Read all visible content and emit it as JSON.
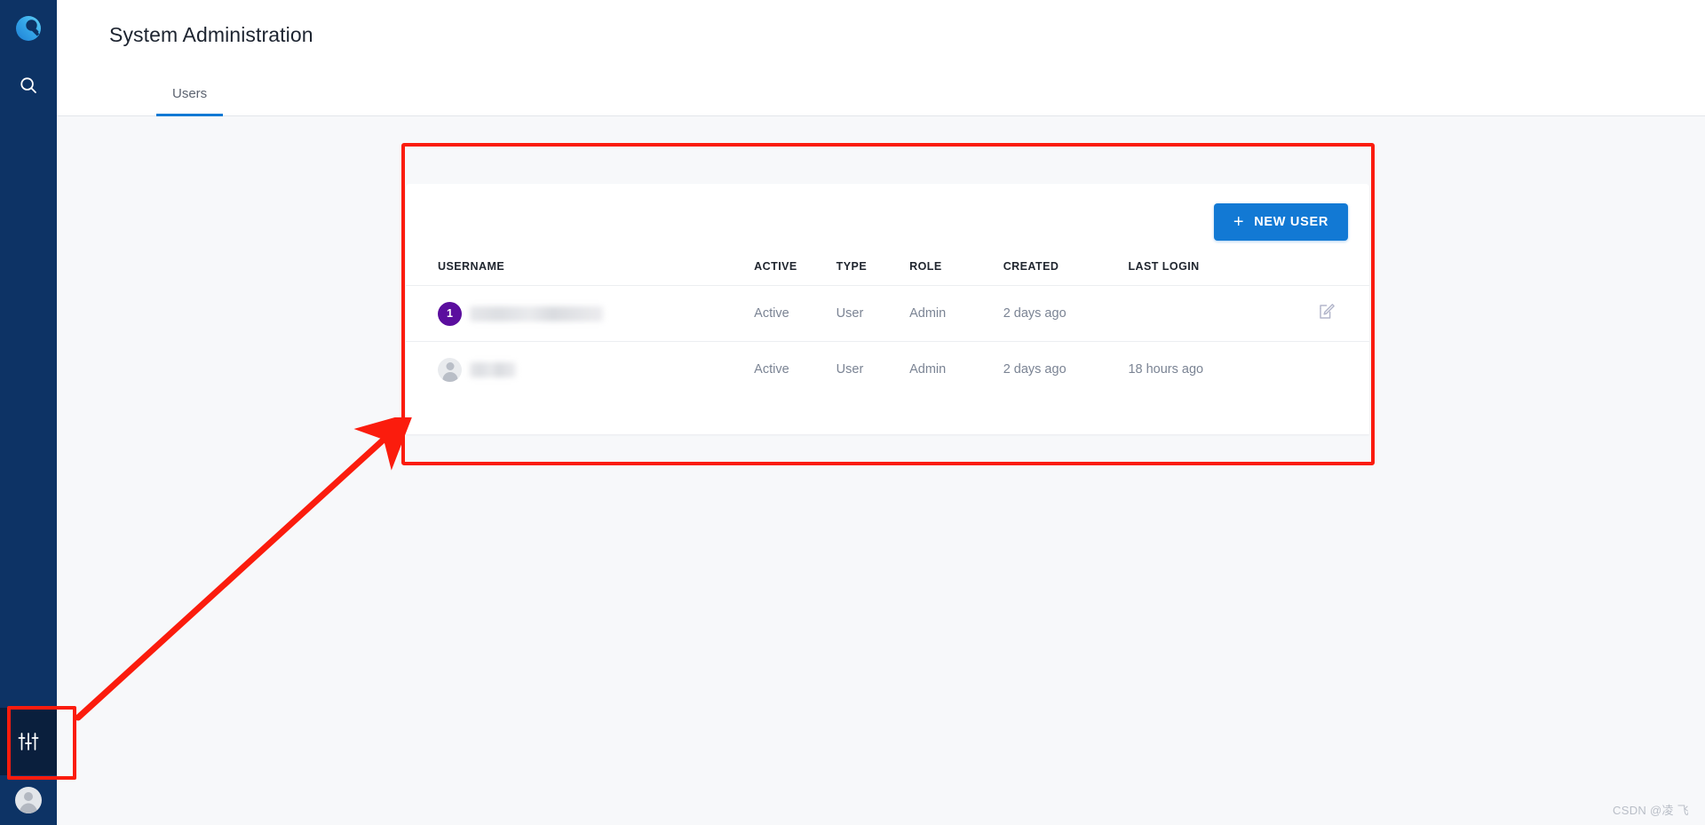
{
  "app": {
    "logo_icon": "app-logo-magnifier-icon",
    "brand_navy": "#0d3365",
    "accent_blue": "#1279d4"
  },
  "sidebar": {
    "items": [
      {
        "icon": "search-icon",
        "name": "search",
        "active": false
      },
      {
        "icon": "sliders-settings-icon",
        "name": "system-administration",
        "active": true
      }
    ],
    "account": {
      "icon": "user-avatar-icon",
      "name": "account"
    }
  },
  "header": {
    "title": "System Administration"
  },
  "tabs": [
    {
      "label": "Users",
      "selected": true
    }
  ],
  "toolbar": {
    "new_user_label": "NEW USER",
    "new_user_icon": "plus-icon"
  },
  "table": {
    "columns": [
      "USERNAME",
      "ACTIVE",
      "TYPE",
      "ROLE",
      "CREATED",
      "LAST LOGIN"
    ],
    "rows": [
      {
        "avatar_type": "badge",
        "avatar_label": "1",
        "avatar_color": "#5b0e9e",
        "username": "",
        "username_redacted": true,
        "active": "Active",
        "type": "User",
        "role": "Admin",
        "created": "2 days ago",
        "last_login": "",
        "action_icon": "edit-icon"
      },
      {
        "avatar_type": "person",
        "avatar_label": "",
        "avatar_color": "#e9ebee",
        "username": "",
        "username_redacted": true,
        "active": "Active",
        "type": "User",
        "role": "Admin",
        "created": "2 days ago",
        "last_login": "18 hours ago",
        "action_icon": ""
      }
    ]
  },
  "annotations": {
    "highlight_color": "#fb1c0d",
    "card_box": true,
    "sidebar_box": true,
    "arrow": true
  },
  "watermark": {
    "text": "CSDN @凌 飞"
  }
}
